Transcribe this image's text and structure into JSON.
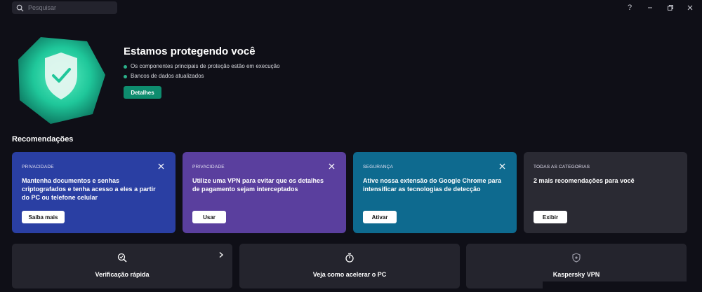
{
  "search": {
    "placeholder": "Pesquisar"
  },
  "window_controls": [
    "help-icon",
    "minimize-icon",
    "restore-icon",
    "close-icon"
  ],
  "hero": {
    "title": "Estamos protegendo você",
    "status_items": [
      "Os componentes principais de proteção estão em execução",
      "Bancos de dados atualizados"
    ],
    "details_label": "Detalhes",
    "accent": "#1fc79a"
  },
  "recommendations": {
    "title": "Recomendações",
    "cards": [
      {
        "category": "PRIVACIDADE",
        "text": "Mantenha documentos e senhas criptografados e tenha acesso a eles a partir do PC ou telefone celular",
        "button": "Saiba mais",
        "color": "#2a3fa3"
      },
      {
        "category": "PRIVACIDADE",
        "text": "Utilize uma VPN para evitar que os detalhes de pagamento sejam interceptados",
        "button": "Usar",
        "color": "#5a3f9e"
      },
      {
        "category": "SEGURANÇA",
        "text": "Ative nossa extensão do Google Chrome para intensificar as tecnologias de detecção",
        "button": "Ativar",
        "color": "#0e6a8f"
      },
      {
        "category": "TODAS AS CATEGORIAS",
        "text": "2 mais recomendações para você",
        "button": "Exibir",
        "color": "#2a2a33"
      }
    ]
  },
  "tiles": [
    {
      "label": "Verificação rápida",
      "icon": "quick-scan-icon"
    },
    {
      "label": "Veja como acelerar o PC",
      "icon": "stopwatch-icon"
    },
    {
      "label": "Kaspersky VPN",
      "icon": "vpn-shield-icon"
    }
  ]
}
